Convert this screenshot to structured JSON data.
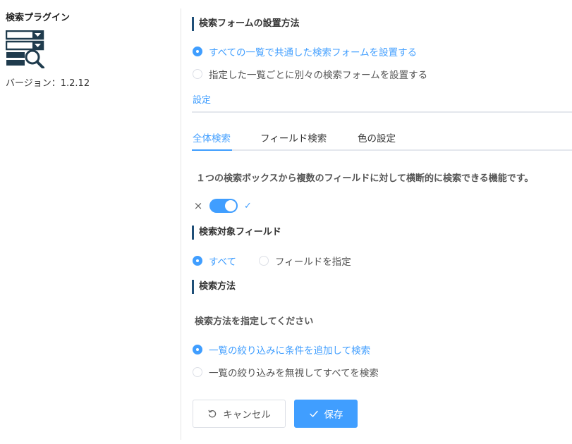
{
  "plugin": {
    "title": "検索プラグイン",
    "version": "バージョン：1.2.12"
  },
  "form_setup": {
    "heading": "検索フォームの設置方法",
    "options": [
      {
        "label": "すべての一覧で共通した検索フォームを設置する",
        "selected": true
      },
      {
        "label": "指定した一覧ごとに別々の検索フォームを設置する",
        "selected": false
      }
    ]
  },
  "main_tabs": [
    {
      "label": "設定",
      "active": true
    }
  ],
  "sub_tabs": [
    {
      "label": "全体検索",
      "active": true
    },
    {
      "label": "フィールド検索",
      "active": false
    },
    {
      "label": "色の設定",
      "active": false
    }
  ],
  "global_search": {
    "description": "１つの検索ボックスから複数のフィールドに対して横断的に検索できる機能です。",
    "toggle": {
      "off_symbol": "×",
      "on_symbol": "✓",
      "enabled": true
    }
  },
  "target_fields": {
    "heading": "検索対象フィールド",
    "options": [
      {
        "label": "すべて",
        "selected": true
      },
      {
        "label": "フィールドを指定",
        "selected": false
      }
    ]
  },
  "search_method": {
    "heading": "検索方法",
    "instruction": "検索方法を指定してください",
    "options": [
      {
        "label": "一覧の絞り込みに条件を追加して検索",
        "selected": true
      },
      {
        "label": "一覧の絞り込みを無視してすべてを検索",
        "selected": false
      }
    ]
  },
  "buttons": {
    "cancel": "キャンセル",
    "save": "保存"
  },
  "colors": {
    "accent": "#409eff",
    "heading_bar": "#1f4f78",
    "logo": "#1f3b4d"
  },
  "icons": {
    "logo": "search-list-logo-icon",
    "cancel": "undo-icon",
    "save": "check-icon"
  }
}
